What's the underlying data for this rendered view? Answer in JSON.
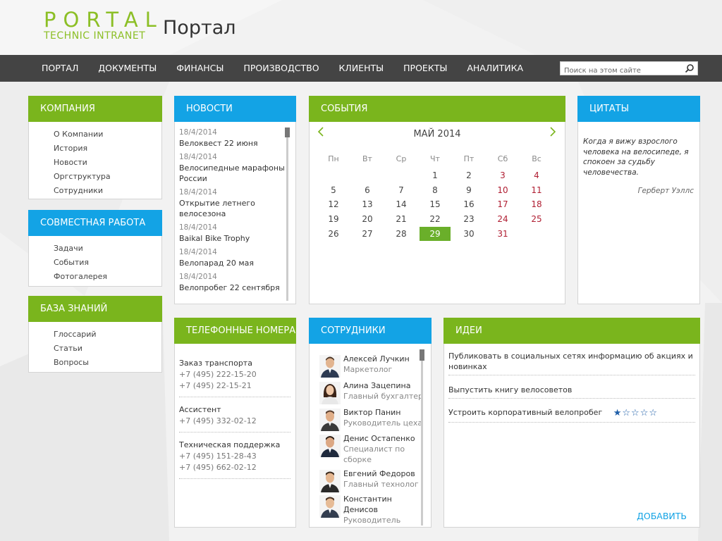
{
  "logo": {
    "top": "PORTAL",
    "sub": "TECHNIC INTRANET"
  },
  "site_title": "Портал",
  "nav": [
    "ПОРТАЛ",
    "ДОКУМЕНТЫ",
    "ФИНАНСЫ",
    "ПРОИЗВОДСТВО",
    "КЛИЕНТЫ",
    "ПРОЕКТЫ",
    "АНАЛИТИКА"
  ],
  "search": {
    "placeholder": "Поиск на этом сайте",
    "icon": "search-icon"
  },
  "company": {
    "title": "КОМПАНИЯ",
    "items": [
      "О Компании",
      "История",
      "Новости",
      "Оргструктура",
      "Сотрудники"
    ]
  },
  "collab": {
    "title": "СОВМЕСТНАЯ РАБОТА",
    "items": [
      "Задачи",
      "События",
      "Фотогалерея"
    ]
  },
  "kb": {
    "title": "БАЗА ЗНАНИЙ",
    "items": [
      "Глоссарий",
      "Статьи",
      "Вопросы"
    ]
  },
  "news": {
    "title": "НОВОСТИ",
    "items": [
      {
        "date": "18/4/2014",
        "title": "Велоквест 22 июня"
      },
      {
        "date": "18/4/2014",
        "title": "Велосипедные марафоны России"
      },
      {
        "date": "18/4/2014",
        "title": "Открытие летнего велосезона"
      },
      {
        "date": "18/4/2014",
        "title": "Baikal Bike Trophy"
      },
      {
        "date": "18/4/2014",
        "title": "Велопарад 20 мая"
      },
      {
        "date": "18/4/2014",
        "title": "Велопробег 22 сентября"
      }
    ]
  },
  "events": {
    "title": "СОБЫТИЯ",
    "month": "МАЙ 2014",
    "weekdays": [
      "Пн",
      "Вт",
      "Ср",
      "Чт",
      "Пт",
      "Сб",
      "Вс"
    ],
    "weeks": [
      [
        "",
        "",
        "",
        "1",
        "2",
        "3",
        "4"
      ],
      [
        "5",
        "6",
        "7",
        "8",
        "9",
        "10",
        "11"
      ],
      [
        "12",
        "13",
        "14",
        "15",
        "16",
        "17",
        "18"
      ],
      [
        "19",
        "20",
        "21",
        "22",
        "23",
        "24",
        "25"
      ],
      [
        "26",
        "27",
        "28",
        "29",
        "30",
        "31",
        ""
      ]
    ],
    "today": "29",
    "weekend_color": "#b01e32",
    "today_color": "#6aaf2a"
  },
  "quotes": {
    "title": "ЦИТАТЫ",
    "text": "Когда я вижу взрослого человека на велосипеде, я спокоен за судьбу человечества.",
    "author": "Герберт Уэллс"
  },
  "phones": {
    "title": "ТЕЛЕФОННЫЕ НОМЕРА",
    "groups": [
      {
        "name": "Заказ транспорта",
        "numbers": [
          "+7 (495) 222-15-20",
          "+7 (495) 22-15-21"
        ]
      },
      {
        "name": "Ассистент",
        "numbers": [
          "+7 (495) 332-02-12"
        ]
      },
      {
        "name": "Техническая поддержка",
        "numbers": [
          "+7 (495) 151-28-43",
          "+7 (495) 662-02-12"
        ]
      }
    ]
  },
  "employees": {
    "title": "СОТРУДНИКИ",
    "items": [
      {
        "name": "Алексей Лучкин",
        "position": "Маркетолог"
      },
      {
        "name": "Алина Зацепина",
        "position": "Главный бухгалтер"
      },
      {
        "name": "Виктор Панин",
        "position": "Руководитель цеха"
      },
      {
        "name": "Денис Остапенко",
        "position": "Специалист по сборке"
      },
      {
        "name": "Евгений Федоров",
        "position": "Главный технолог"
      },
      {
        "name": "Константин Денисов",
        "position": "Руководитель"
      }
    ]
  },
  "ideas": {
    "title": "ИДЕИ",
    "items": [
      "Публиковать в социальных сетях информацию об акциях и новинках",
      "Выпустить книгу велосоветов",
      "Устроить корпоративный велопробег"
    ],
    "rating": {
      "value": 1,
      "max": 5
    },
    "add_label": "ДОБАВИТЬ"
  },
  "colors": {
    "green": "#7ab51d",
    "blue": "#13a3e5",
    "nav_bg": "#444444"
  }
}
